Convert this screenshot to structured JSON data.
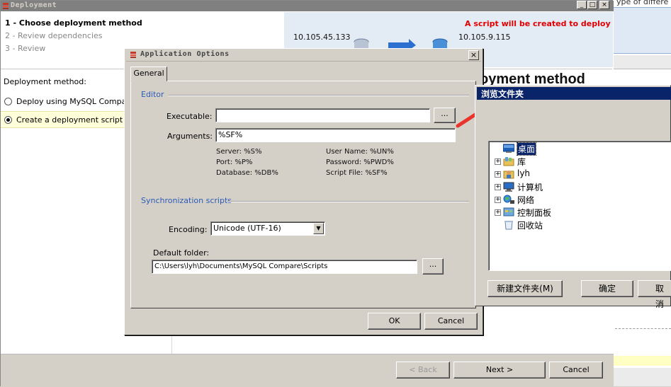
{
  "background_right": {
    "partial_text": "ype of differe"
  },
  "deployment": {
    "title": "Deployment",
    "window_buttons": [
      "_",
      "□",
      "×"
    ],
    "steps": [
      "1 - Choose deployment method",
      "2 - Review dependencies",
      "3 - Review"
    ],
    "script_note": "A script will be created to deploy",
    "source_ip": "10.105.45.133",
    "target_ip": "10.105.9.115",
    "method_label": "Deployment method:",
    "options": [
      {
        "label": "Deploy using MySQL Compare",
        "selected": false
      },
      {
        "label": "Create a deployment script",
        "selected": true
      }
    ],
    "heading_partial": "oyment method",
    "footer": {
      "back": "< Back",
      "next": "Next >",
      "cancel": "Cancel"
    }
  },
  "options_dialog": {
    "title": "Application Options",
    "close_glyph": "×",
    "tab": "General",
    "editor": {
      "heading": "Editor",
      "executable_label": "Executable:",
      "executable_value": "",
      "browse_label": "...",
      "arguments_label": "Arguments:",
      "arguments_value": "%SF%",
      "macros": [
        "Server: %S%",
        "User Name: %UN%",
        "Port: %P%",
        "Password: %PWD%",
        "Database: %DB%",
        "Script File: %SF%"
      ]
    },
    "sync": {
      "heading": "Synchronization scripts",
      "encoding_label": "Encoding:",
      "encoding_value": "Unicode (UTF-16)",
      "folder_label": "Default folder:",
      "folder_value": "C:\\Users\\lyh\\Documents\\MySQL Compare\\Scripts",
      "folder_browse": "..."
    },
    "ok": "OK",
    "cancel": "Cancel"
  },
  "browse_dialog": {
    "title": "浏览文件夹",
    "tree": [
      {
        "label": "桌面",
        "icon": "desktop-icon",
        "expandable": false,
        "selected": true
      },
      {
        "label": "库",
        "icon": "library-icon",
        "expandable": true,
        "selected": false
      },
      {
        "label": "lyh",
        "icon": "user-folder-icon",
        "expandable": true,
        "selected": false
      },
      {
        "label": "计算机",
        "icon": "computer-icon",
        "expandable": true,
        "selected": false
      },
      {
        "label": "网络",
        "icon": "network-icon",
        "expandable": true,
        "selected": false
      },
      {
        "label": "控制面板",
        "icon": "control-panel-icon",
        "expandable": true,
        "selected": false
      },
      {
        "label": "回收站",
        "icon": "recycle-bin-icon",
        "expandable": false,
        "selected": false
      }
    ],
    "new_folder": "新建文件夹(M)",
    "ok": "确定",
    "cancel": "取消"
  },
  "colors": {
    "script_note": "#e00000",
    "group_heading": "#2b5cb7",
    "browse_title_bg": "#0a246a",
    "arrow": "#e8342c"
  }
}
